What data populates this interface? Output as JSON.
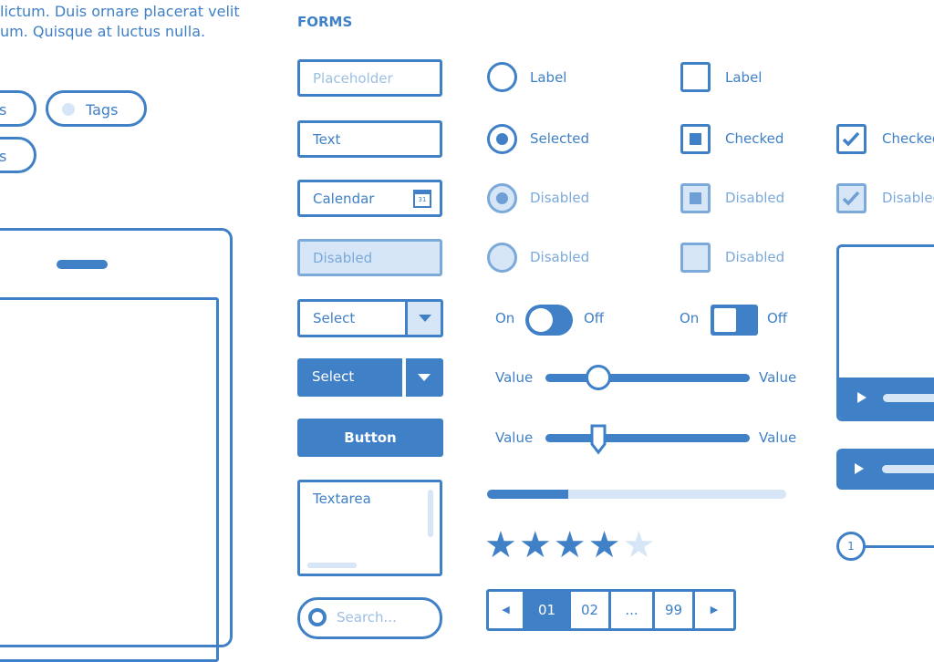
{
  "intro": {
    "line1": "lictum. Duis ornare placerat velit",
    "line2": "um. Quisque at luctus nulla."
  },
  "tags": [
    {
      "label": "s"
    },
    {
      "label": "Tags"
    },
    {
      "label": "s"
    }
  ],
  "forms": {
    "title": "FORMS",
    "placeholder": "Placeholder",
    "text": "Text",
    "calendar": "Calendar",
    "calendar_day": "31",
    "disabled": "Disabled",
    "select1": "Select",
    "select2": "Select",
    "button": "Button",
    "textarea": "Textarea",
    "search_placeholder": "Search..."
  },
  "radios": [
    {
      "label": "Label",
      "state": "unchecked"
    },
    {
      "label": "Selected",
      "state": "selected"
    },
    {
      "label": "Disabled",
      "state": "disabled-selected"
    },
    {
      "label": "Disabled",
      "state": "disabled"
    }
  ],
  "checkboxes": [
    {
      "label": "Label",
      "state": "unchecked"
    },
    {
      "label": "Checked",
      "state": "checked"
    },
    {
      "label": "Disabled",
      "state": "disabled-checked"
    },
    {
      "label": "Disabled",
      "state": "disabled"
    }
  ],
  "checkmarks": [
    {
      "label": "Checked",
      "state": "checked"
    },
    {
      "label": "Disabled",
      "state": "disabled-checked"
    }
  ],
  "toggles": [
    {
      "on": "On",
      "off": "Off",
      "value": "on"
    },
    {
      "on": "On",
      "off": "Off",
      "value": "on"
    }
  ],
  "sliders": [
    {
      "min_label": "Value",
      "max_label": "Value",
      "value": 0.26
    },
    {
      "min_label": "Value",
      "max_label": "Value",
      "value": 0.26
    }
  ],
  "progress": {
    "value": 0.27
  },
  "rating": {
    "value": 4,
    "max": 5
  },
  "pagination": {
    "prev": "◀",
    "pages": [
      "01",
      "02",
      "...",
      "99"
    ],
    "active": "01",
    "next": "▶"
  },
  "stepper": {
    "step": "1"
  },
  "colors": {
    "primary": "#3f80c6",
    "light": "#d6e6f6"
  }
}
